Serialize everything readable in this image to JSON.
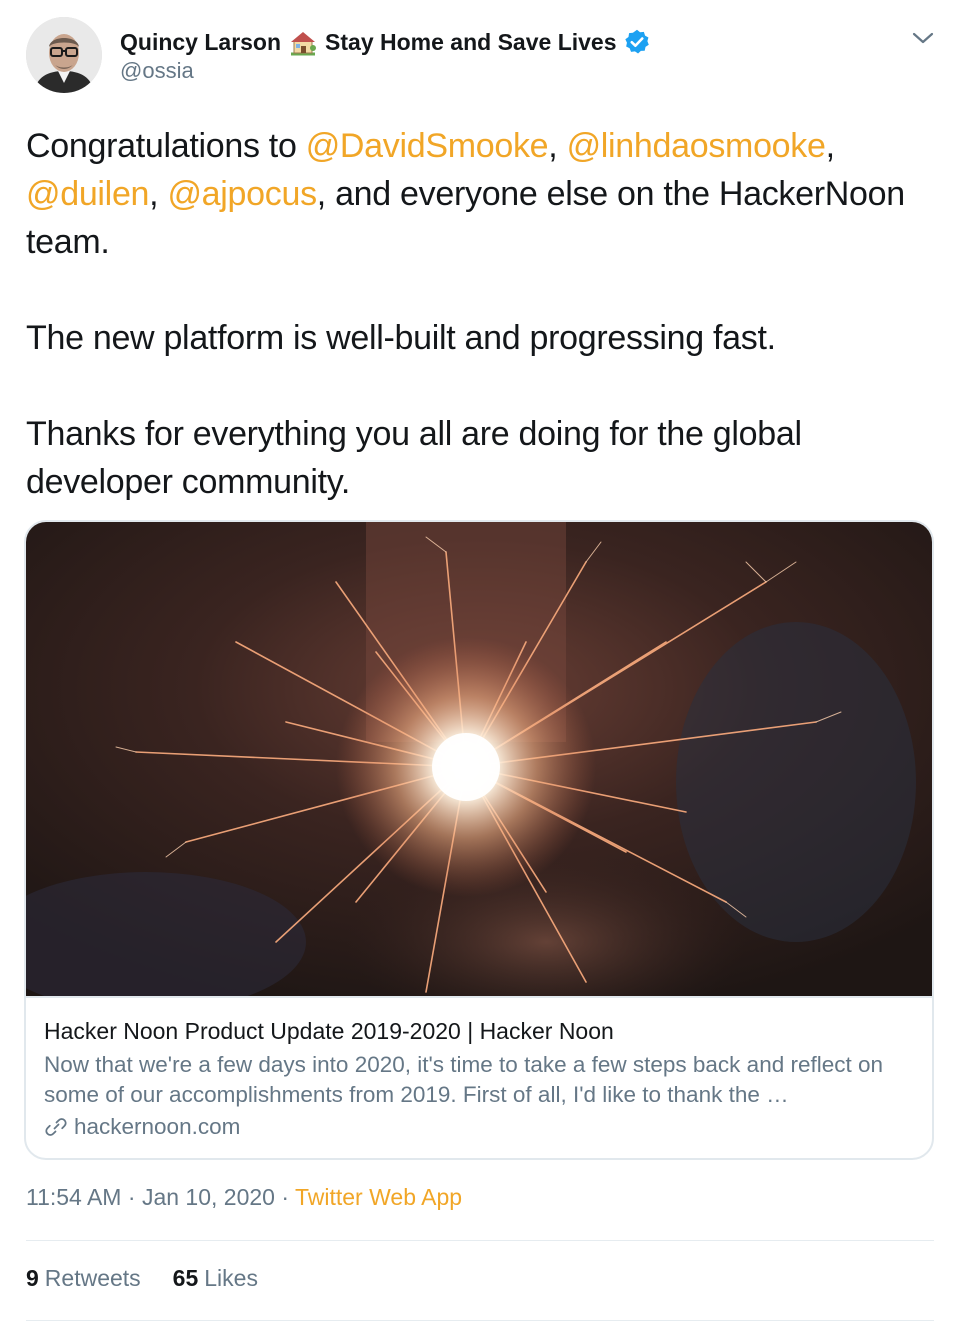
{
  "author": {
    "name": "Quincy Larson",
    "display_suffix": "Stay Home and Save Lives",
    "handle": "@ossia",
    "verified": true
  },
  "tweet": {
    "line1_prefix": "Congratulations to ",
    "mention1": "@DavidSmooke",
    "sep1": ", ",
    "mention2": "@linhdaosmooke",
    "sep2": ",",
    "mention3": "@duilen",
    "sep3": ", ",
    "mention4": "@ajpocus",
    "line_suffix": ", and everyone else on the HackerNoon team.",
    "para2": "The new platform is well-built and progressing fast.",
    "para3": "Thanks for everything you all are doing for the global developer community."
  },
  "card": {
    "title": "Hacker Noon Product Update 2019-2020 | Hacker Noon",
    "description": "Now that we're a few days into 2020, it's time to take a few steps back and reflect on some of our accomplishments from 2019. First of all, I'd like to thank the …",
    "domain": "hackernoon.com",
    "image_alt_icon": "sparkler-photo"
  },
  "meta": {
    "time": "11:54 AM",
    "dot1": " · ",
    "date": "Jan 10, 2020",
    "dot2": " · ",
    "source": "Twitter Web App"
  },
  "stats": {
    "retweets_count": "9",
    "retweets_label": "Retweets",
    "likes_count": "65",
    "likes_label": "Likes"
  },
  "colors": {
    "accent": "#f1a627",
    "verified": "#1da1f2",
    "muted": "#657786",
    "text": "#14171a"
  }
}
